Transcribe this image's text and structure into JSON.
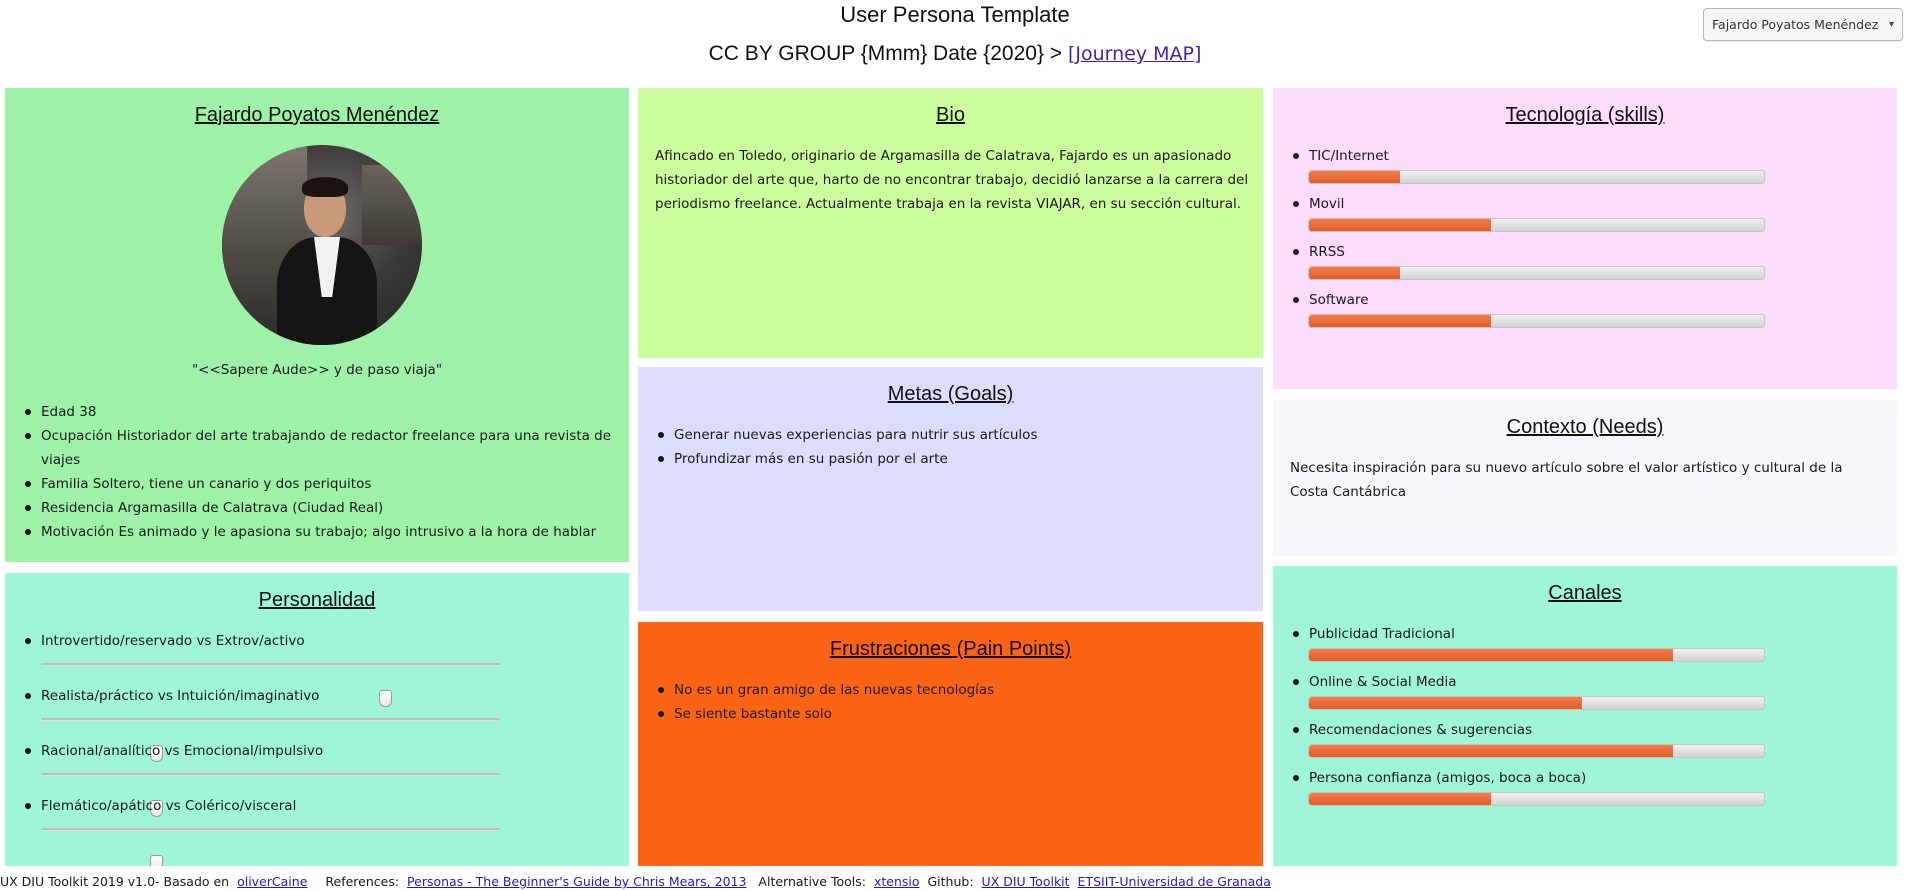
{
  "header": {
    "title": "User Persona Template",
    "subtitle_prefix": "CC BY GROUP {Mmm} Date {2020} >",
    "journey_link": "[Journey MAP]"
  },
  "persona_select": {
    "selected": "Fajardo Poyatos Menéndez"
  },
  "persona": {
    "name": "Fajardo Poyatos Menéndez",
    "quote": "\"<<Sapere Aude>> y de paso viaja\"",
    "facts": [
      "Edad 38",
      "Ocupación Historiador del arte trabajando de redactor freelance para una revista de viajes",
      "Familia Soltero, tiene un canario y dos periquitos",
      "Residencia Argamasilla de Calatrava (Ciudad Real)",
      "Motivación Es animado y le apasiona su trabajo; algo intrusivo a la hora de hablar"
    ]
  },
  "bio": {
    "title": "Bio",
    "text": "Afincado en Toledo, originario de Argamasilla de Calatrava, Fajardo es un apasionado historiador del arte que, harto de no encontrar trabajo, decidió lanzarse a la carrera del periodismo freelance. Actualmente trabaja en la revista VIAJAR, en su sección cultural."
  },
  "goals": {
    "title": "Metas (Goals)",
    "items": [
      "Generar nuevas experiencias para nutrir sus artículos",
      "Profundizar más en su pasión por el arte"
    ]
  },
  "frustrations": {
    "title": "Frustraciones (Pain Points)",
    "items": [
      "No es un gran amigo de las nuevas tecnologías",
      "Se siente bastante solo"
    ]
  },
  "tech": {
    "title": "Tecnología (skills)",
    "skills": [
      {
        "label": "TIC/Internet",
        "value": 0.2
      },
      {
        "label": "Movil",
        "value": 0.4
      },
      {
        "label": "RRSS",
        "value": 0.2
      },
      {
        "label": "Software",
        "value": 0.4
      }
    ]
  },
  "context": {
    "title": "Contexto (Needs)",
    "text": "Necesita inspiración para su nuevo artículo sobre el valor artístico y cultural de la Costa Cantábrica"
  },
  "channels": {
    "title": "Canales",
    "items": [
      {
        "label": "Publicidad Tradicional",
        "value": 0.8
      },
      {
        "label": "Online & Social Media",
        "value": 0.6
      },
      {
        "label": "Recomendaciones & sugerencias",
        "value": 0.8
      },
      {
        "label": "Persona confianza (amigos, boca a boca)",
        "value": 0.4
      }
    ]
  },
  "personality": {
    "title": "Personalidad",
    "traits": [
      {
        "label": "Introvertido/reservado vs Extrov/activo",
        "value": 0.75
      },
      {
        "label": "Realista/práctico vs Intuición/imaginativo",
        "value": 0.25
      },
      {
        "label": "Racional/analítico vs Emocional/impulsivo",
        "value": 0.25
      },
      {
        "label": "Flemático/apático vs Colérico/visceral",
        "value": 0.25
      }
    ]
  },
  "footer": {
    "toolkit_text": "UX DIU Toolkit 2019 v1.0- Basado en",
    "based_link": "oliverCaine",
    "references_label": "References:",
    "references_link": "Personas - The Beginner's Guide by Chris Mears, 2013",
    "alt_tools_label": "Alternative Tools:",
    "alt_tools_link": "xtensio",
    "github_label": "Github:",
    "github_link": "UX DIU Toolkit",
    "university_link": "ETSIIT-Universidad de Granada"
  },
  "colors": {
    "persona_card": "#9df2a8",
    "bio_card": "#ccfd9c",
    "goals_card": "#dcdcfd",
    "frustrations_card": "#fc6415",
    "tech_card": "#fddcfc",
    "context_card": "#f6f7fa",
    "channels_card": "#9ef5d8",
    "personality_card": "#9ef5d8",
    "bar_fill": "#e55b25"
  }
}
